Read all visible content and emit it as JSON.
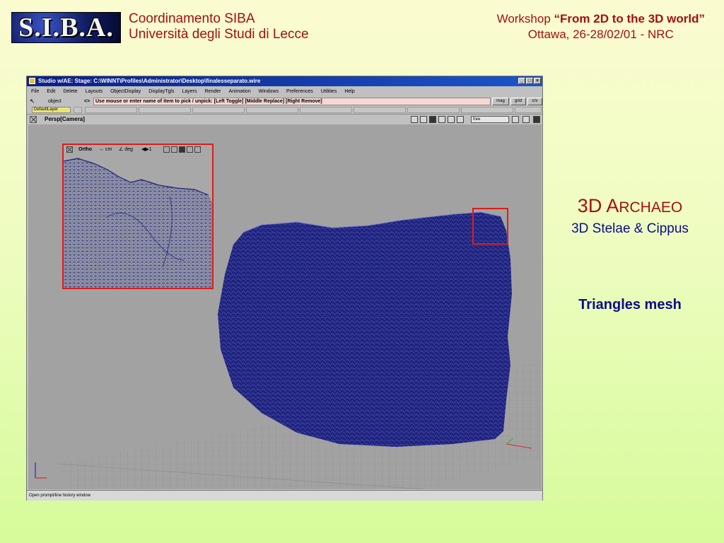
{
  "header": {
    "logo_text": "S.I.B.A.",
    "org_line1": "Coordinamento SIBA",
    "org_line2": "Università degli Studi di Lecce",
    "workshop_prefix": "Workshop ",
    "workshop_title": "“From 2D to the 3D world”",
    "workshop_place": "Ottawa, 26-28/02/01 - NRC"
  },
  "sidebar": {
    "title_prefix": "3D A",
    "title_rest": "RCHAEO",
    "subtitle": "3D Stelae & Cippus",
    "mesh_label": "Triangles mesh"
  },
  "app": {
    "window_title": "Studio w/AE: Stage: C:\\WINNT\\Profiles\\Administrator\\Desktop\\finalesseparato.wire",
    "menu": [
      "File",
      "Edit",
      "Delete",
      "Layouts",
      "ObjectDisplay",
      "DisplayTgls",
      "Layers",
      "Render",
      "Animation",
      "Windows",
      "Preferences",
      "Utilities",
      "Help"
    ],
    "pick_mode": "object",
    "arrows": "<>",
    "prompt": "Use mouse or enter name of item to pick / unpick: [Left Toggle] [Middle Replace] [Right Remove]",
    "buttons": [
      "mag",
      "grid",
      "crv"
    ],
    "default_layer": "DefaultLayer",
    "viewport_title": "Persp[Camera]",
    "camera_mode": "free",
    "inset": {
      "title": "Ortho",
      "units": "↔ cm",
      "angle": "∠ deg",
      "scale": "◀▶1"
    },
    "status_text": "Open prompt/line history window"
  },
  "colors": {
    "accent_red": "#a41010",
    "accent_blue": "#0b0d8a",
    "mesh_blue": "#1a1e78",
    "highlight_red": "#e01b1b"
  },
  "icons": [
    "logo",
    "pick-arrow-icon",
    "viewport-close-icon",
    "viewport-tool-icons",
    "axis-icon"
  ]
}
